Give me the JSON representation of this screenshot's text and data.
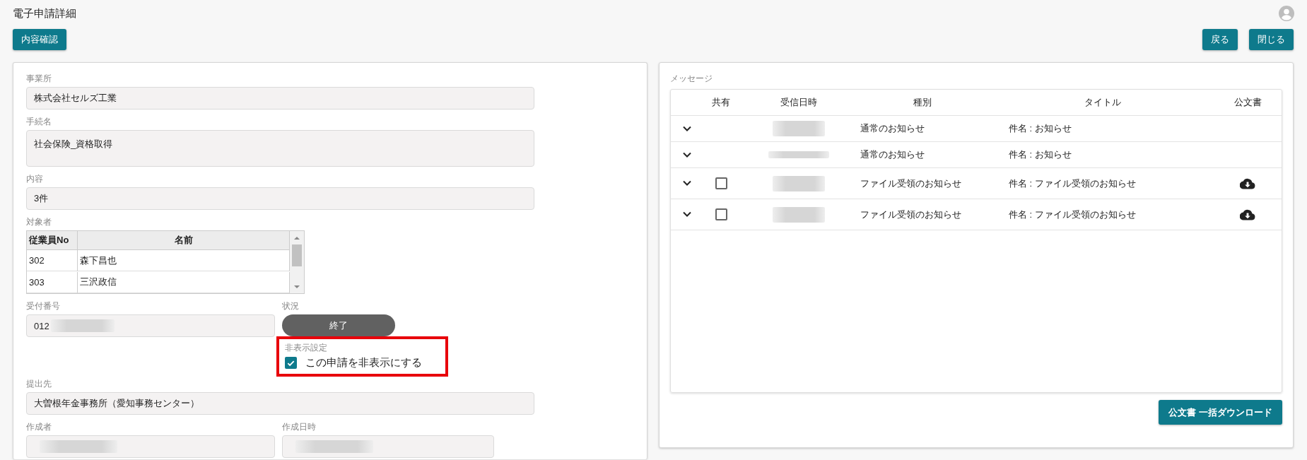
{
  "page": {
    "title": "電子申請詳細"
  },
  "toolbar": {
    "left_buttons": [
      "内容確認"
    ],
    "right_buttons": [
      "戻る",
      "閉じる"
    ]
  },
  "application": {
    "office": {
      "label": "事業所",
      "value": "株式会社セルズ工業"
    },
    "procedure": {
      "label": "手続名",
      "value": "社会保険_資格取得"
    },
    "content": {
      "label": "内容",
      "value": "3件"
    },
    "targets": {
      "label": "対象者",
      "columns": [
        "従業員No",
        "名前"
      ],
      "rows": [
        [
          "302",
          "森下昌也"
        ],
        [
          "303",
          "三沢政信"
        ]
      ]
    },
    "receipt_number": {
      "label": "受付番号",
      "value": "012",
      "redacted": true
    },
    "status": {
      "label": "状況",
      "value": "終了"
    },
    "hide_setting": {
      "label": "非表示設定",
      "option": "この申請を非表示にする",
      "checked": true,
      "highlighted": true
    },
    "submit_to": {
      "label": "提出先",
      "value": "大曽根年金事務所（愛知事務センター）"
    },
    "creator": {
      "label": "作成者",
      "redacted": true
    },
    "created_at": {
      "label": "作成日時",
      "redacted": true
    }
  },
  "messages": {
    "label": "メッセージ",
    "columns": [
      "共有",
      "受信日時",
      "種別",
      "タイトル",
      "公文書"
    ],
    "rows": [
      {
        "kind": "plain",
        "expanded": false,
        "date_redacted": true,
        "type": "通常のお知らせ",
        "title": "件名 : お知らせ",
        "document": false
      },
      {
        "kind": "plain",
        "expanded": false,
        "date_redacted": true,
        "type": "通常のお知らせ",
        "title": "件名 : お知らせ",
        "document": false
      },
      {
        "kind": "shareable",
        "expanded": false,
        "shared": false,
        "date_redacted": true,
        "type": "ファイル受領のお知らせ",
        "title": "件名 : ファイル受領のお知らせ",
        "document": true
      },
      {
        "kind": "shareable",
        "expanded": false,
        "shared": false,
        "date_redacted": true,
        "type": "ファイル受領のお知らせ",
        "title": "件名 : ファイル受領のお知らせ",
        "document": true
      }
    ],
    "bulk_download": "公文書 一括ダウンロード"
  }
}
